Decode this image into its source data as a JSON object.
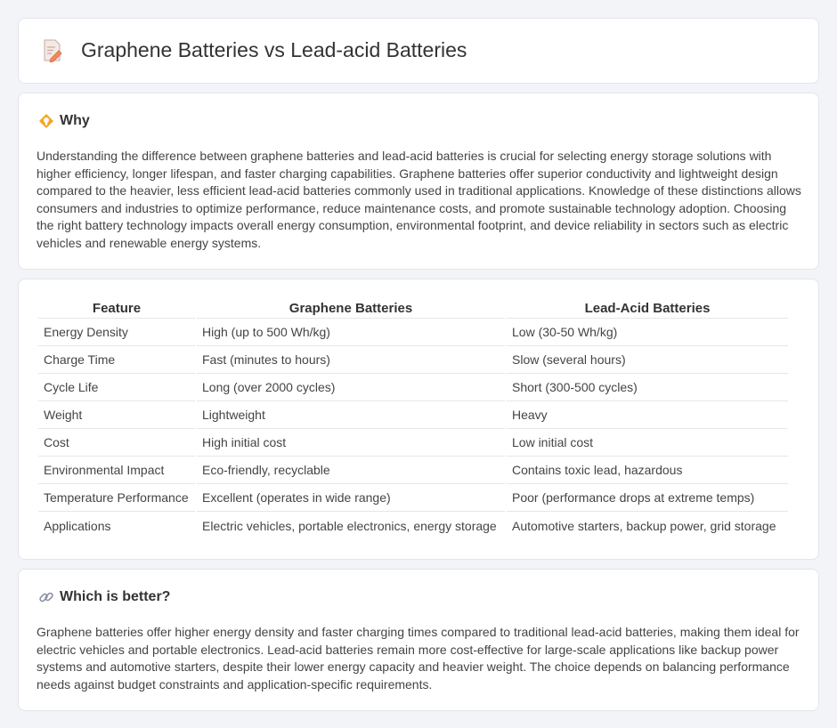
{
  "header": {
    "title": "Graphene Batteries vs Lead-acid Batteries",
    "icon": "document-edit-icon"
  },
  "why": {
    "title": "Why",
    "icon": "bulb-diamond-icon",
    "text": "Understanding the difference between graphene batteries and lead-acid batteries is crucial for selecting energy storage solutions with higher efficiency, longer lifespan, and faster charging capabilities. Graphene batteries offer superior conductivity and lightweight design compared to the heavier, less efficient lead-acid batteries commonly used in traditional applications. Knowledge of these distinctions allows consumers and industries to optimize performance, reduce maintenance costs, and promote sustainable technology adoption. Choosing the right battery technology impacts overall energy consumption, environmental footprint, and device reliability in sectors such as electric vehicles and renewable energy systems."
  },
  "table": {
    "headers": [
      "Feature",
      "Graphene Batteries",
      "Lead-Acid Batteries"
    ],
    "rows": [
      [
        "Energy Density",
        "High (up to 500 Wh/kg)",
        "Low (30-50 Wh/kg)"
      ],
      [
        "Charge Time",
        "Fast (minutes to hours)",
        "Slow (several hours)"
      ],
      [
        "Cycle Life",
        "Long (over 2000 cycles)",
        "Short (300-500 cycles)"
      ],
      [
        "Weight",
        "Lightweight",
        "Heavy"
      ],
      [
        "Cost",
        "High initial cost",
        "Low initial cost"
      ],
      [
        "Environmental Impact",
        "Eco-friendly, recyclable",
        "Contains toxic lead, hazardous"
      ],
      [
        "Temperature Performance",
        "Excellent (operates in wide range)",
        "Poor (performance drops at extreme temps)"
      ],
      [
        "Applications",
        "Electric vehicles, portable electronics, energy storage",
        "Automotive starters, backup power, grid storage"
      ]
    ]
  },
  "better": {
    "title": "Which is better?",
    "icon": "link-icon",
    "text": "Graphene batteries offer higher energy density and faster charging times compared to traditional lead-acid batteries, making them ideal for electric vehicles and portable electronics. Lead-acid batteries remain more cost-effective for large-scale applications like backup power systems and automotive starters, despite their lower energy capacity and heavier weight. The choice depends on balancing performance needs against budget constraints and application-specific requirements."
  }
}
